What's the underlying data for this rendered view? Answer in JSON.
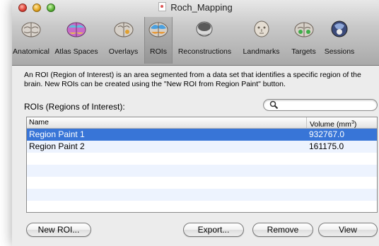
{
  "window": {
    "title": "Roch_Mapping"
  },
  "toolbar": {
    "items": [
      {
        "label": "Anatomical",
        "icon": "brain-anatomical-icon",
        "selected": false
      },
      {
        "label": "Atlas Spaces",
        "icon": "brain-atlas-icon",
        "selected": false
      },
      {
        "label": "Overlays",
        "icon": "brain-overlay-icon",
        "selected": false
      },
      {
        "label": "ROIs",
        "icon": "brain-roi-icon",
        "selected": true
      },
      {
        "label": "Reconstructions",
        "icon": "head-reconstruction-icon",
        "selected": false
      },
      {
        "label": "Landmarks",
        "icon": "head-landmarks-icon",
        "selected": false
      },
      {
        "label": "Targets",
        "icon": "brain-targets-icon",
        "selected": false
      },
      {
        "label": "Sessions",
        "icon": "head-sessions-icon",
        "selected": false
      }
    ]
  },
  "content": {
    "description": "An ROI (Region of Interest) is an area segmented from a data set that identifies a specific region of the brain. New ROIs can be created using the \"New ROI from Region Paint\" button.",
    "rois_label": "ROIs (Regions of Interest):",
    "search": {
      "value": "",
      "placeholder": ""
    }
  },
  "table": {
    "columns": {
      "name": "Name",
      "volume": "Volume (mm",
      "volume_sup": "3",
      "volume_close": ")"
    },
    "rows": [
      {
        "name": "Region Paint 1",
        "volume": "932767.0",
        "selected": true
      },
      {
        "name": "Region Paint 2",
        "volume": "161175.0",
        "selected": false
      }
    ]
  },
  "buttons": {
    "new_roi": "New ROI...",
    "export": "Export...",
    "remove": "Remove",
    "view": "View"
  },
  "colors": {
    "selection": "#3875d7",
    "window_bg": "#ececec"
  }
}
